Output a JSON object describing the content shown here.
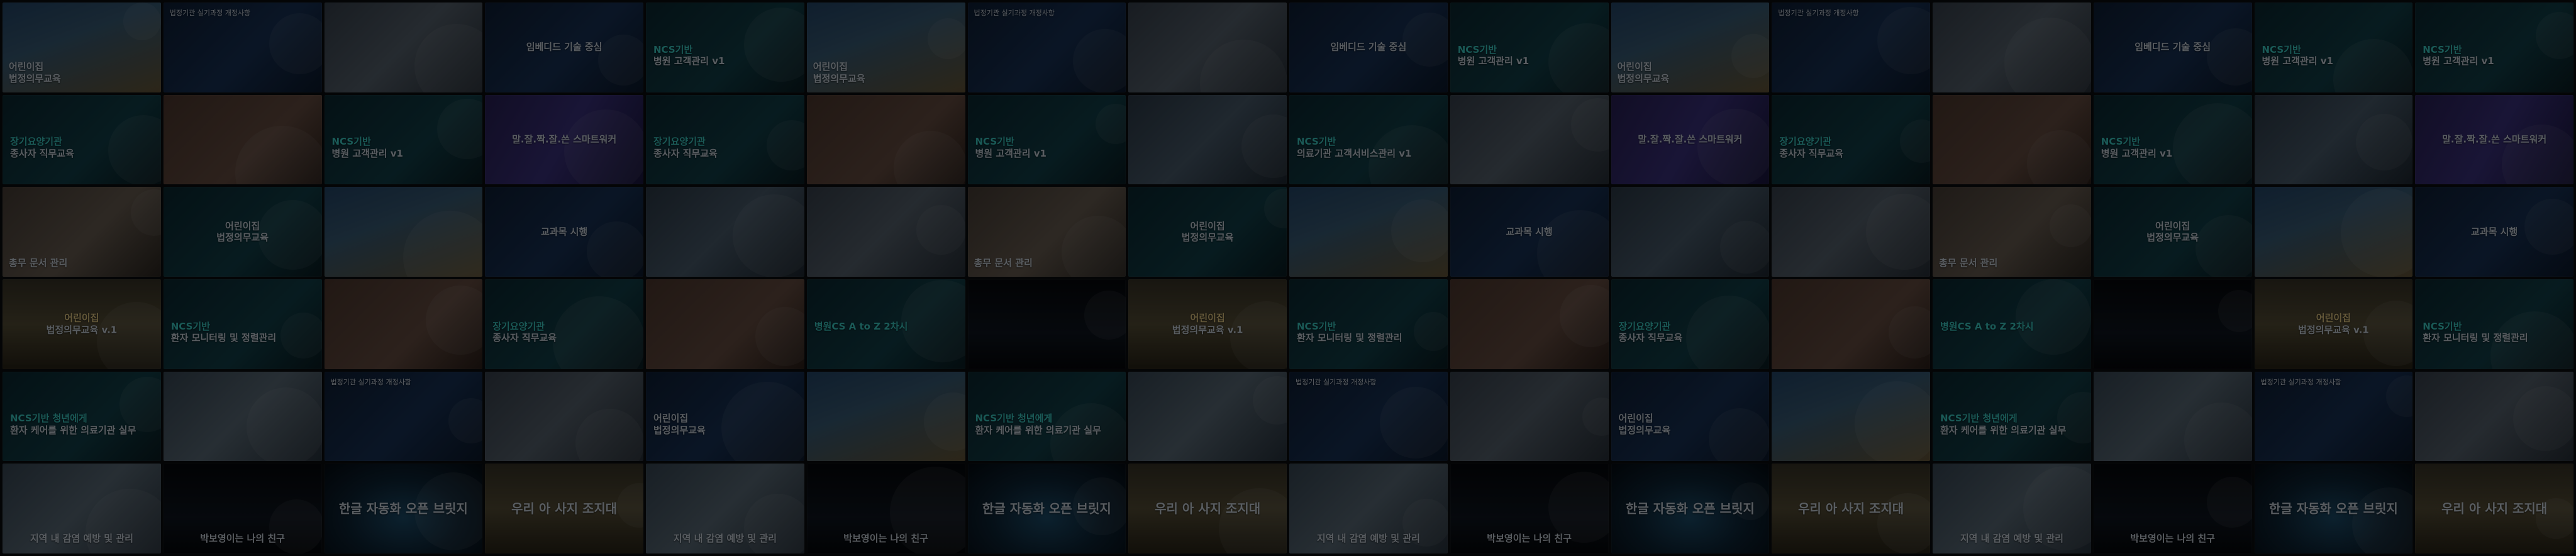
{
  "tiles": [
    {
      "theme": "t-cartoon",
      "texts": [
        {
          "t": "어린이집",
          "c": "pos-bl",
          "a": ""
        },
        {
          "t": "법정의무교육",
          "c": "pos-bl",
          "a": ""
        }
      ]
    },
    {
      "theme": "t-navy",
      "texts": [
        {
          "t": "법정기관 실기과정 개정사항",
          "c": "pos-tl",
          "a": ""
        }
      ]
    },
    {
      "theme": "t-doctor",
      "texts": []
    },
    {
      "theme": "t-navy",
      "texts": [
        {
          "t": "임베디드 기술 중심",
          "c": "pos-c",
          "a": ""
        }
      ]
    },
    {
      "theme": "t-teal",
      "texts": [
        {
          "t": "NCS기반",
          "c": "pos-ml",
          "a": "accent-cyan"
        },
        {
          "t": "병원 고객관리 v1",
          "c": "pos-ml",
          "a": ""
        }
      ]
    },
    {
      "theme": "t-cartoon",
      "texts": [
        {
          "t": "어린이집",
          "c": "pos-bl",
          "a": ""
        },
        {
          "t": "법정의무교육",
          "c": "pos-bl",
          "a": ""
        }
      ]
    },
    {
      "theme": "t-navy",
      "texts": [
        {
          "t": "법정기관 실기과정 개정사항",
          "c": "pos-tl",
          "a": ""
        }
      ]
    },
    {
      "theme": "t-doctor",
      "texts": []
    },
    {
      "theme": "t-navy",
      "texts": [
        {
          "t": "임베디드 기술 중심",
          "c": "pos-c",
          "a": ""
        }
      ]
    },
    {
      "theme": "t-teal",
      "texts": [
        {
          "t": "NCS기반",
          "c": "pos-ml",
          "a": "accent-cyan"
        },
        {
          "t": "병원 고객관리 v1",
          "c": "pos-ml",
          "a": ""
        }
      ]
    },
    {
      "theme": "t-cartoon",
      "texts": [
        {
          "t": "어린이집",
          "c": "pos-bl",
          "a": ""
        },
        {
          "t": "법정의무교육",
          "c": "pos-bl",
          "a": ""
        }
      ]
    },
    {
      "theme": "t-navy",
      "texts": [
        {
          "t": "법정기관 실기과정 개정사항",
          "c": "pos-tl",
          "a": ""
        }
      ]
    },
    {
      "theme": "t-doctor",
      "texts": []
    },
    {
      "theme": "t-navy",
      "texts": [
        {
          "t": "임베디드 기술 중심",
          "c": "pos-c",
          "a": ""
        }
      ]
    },
    {
      "theme": "t-teal",
      "texts": [
        {
          "t": "NCS기반",
          "c": "pos-ml",
          "a": "accent-cyan"
        },
        {
          "t": "병원 고객관리 v1",
          "c": "pos-ml",
          "a": ""
        }
      ]
    },
    {
      "theme": "t-teal",
      "texts": [
        {
          "t": "NCS기반",
          "c": "pos-ml",
          "a": "accent-cyan"
        },
        {
          "t": "병원 고객관리 v1",
          "c": "pos-ml",
          "a": ""
        }
      ]
    },
    {
      "theme": "t-teal",
      "texts": [
        {
          "t": "장기요양기관",
          "c": "pos-ml",
          "a": "accent-cyan"
        },
        {
          "t": "종사자 직무교육",
          "c": "pos-ml",
          "a": ""
        }
      ]
    },
    {
      "theme": "t-hands",
      "texts": []
    },
    {
      "theme": "t-teal",
      "texts": [
        {
          "t": "NCS기반",
          "c": "pos-ml",
          "a": "accent-cyan"
        },
        {
          "t": "병원 고객관리 v1",
          "c": "pos-ml",
          "a": ""
        }
      ]
    },
    {
      "theme": "t-purple",
      "texts": [
        {
          "t": "말.잘.짝.잘.쓴 스마트워커",
          "c": "pos-c",
          "a": ""
        }
      ]
    },
    {
      "theme": "t-teal",
      "texts": [
        {
          "t": "장기요양기관",
          "c": "pos-ml",
          "a": "accent-cyan"
        },
        {
          "t": "종사자 직무교육",
          "c": "pos-ml",
          "a": ""
        }
      ]
    },
    {
      "theme": "t-hands",
      "texts": []
    },
    {
      "theme": "t-teal",
      "texts": [
        {
          "t": "NCS기반",
          "c": "pos-ml",
          "a": "accent-cyan"
        },
        {
          "t": "병원 고객관리 v1",
          "c": "pos-ml",
          "a": ""
        }
      ]
    },
    {
      "theme": "t-med",
      "texts": []
    },
    {
      "theme": "t-teal",
      "texts": [
        {
          "t": "NCS기반",
          "c": "pos-ml",
          "a": "accent-cyan"
        },
        {
          "t": "의료기관 고객서비스관리 v1",
          "c": "pos-ml",
          "a": ""
        }
      ]
    },
    {
      "theme": "t-doctor",
      "texts": []
    },
    {
      "theme": "t-purple",
      "texts": [
        {
          "t": "말.잘.짝.잘.쓴 스마트워커",
          "c": "pos-c",
          "a": ""
        }
      ]
    },
    {
      "theme": "t-teal",
      "texts": [
        {
          "t": "장기요양기관",
          "c": "pos-ml",
          "a": "accent-cyan"
        },
        {
          "t": "종사자 직무교육",
          "c": "pos-ml",
          "a": ""
        }
      ]
    },
    {
      "theme": "t-hands",
      "texts": []
    },
    {
      "theme": "t-teal",
      "texts": [
        {
          "t": "NCS기반",
          "c": "pos-ml",
          "a": "accent-cyan"
        },
        {
          "t": "병원 고객관리 v1",
          "c": "pos-ml",
          "a": ""
        }
      ]
    },
    {
      "theme": "t-med",
      "texts": []
    },
    {
      "theme": "t-purple",
      "texts": [
        {
          "t": "말.잘.짝.잘.쓴 스마트워커",
          "c": "pos-c",
          "a": ""
        }
      ]
    },
    {
      "theme": "t-photo",
      "texts": [
        {
          "t": "총무 문서 관리",
          "c": "pos-bl",
          "a": ""
        }
      ]
    },
    {
      "theme": "t-teal",
      "texts": [
        {
          "t": "어린이집",
          "c": "pos-c",
          "a": ""
        },
        {
          "t": "법정의무교육",
          "c": "pos-c",
          "a": ""
        }
      ]
    },
    {
      "theme": "t-cartoon",
      "texts": []
    },
    {
      "theme": "t-navy",
      "texts": [
        {
          "t": "교과목 시행",
          "c": "pos-c",
          "a": ""
        }
      ]
    },
    {
      "theme": "t-med",
      "texts": []
    },
    {
      "theme": "t-doctor",
      "texts": []
    },
    {
      "theme": "t-photo",
      "texts": [
        {
          "t": "총무 문서 관리",
          "c": "pos-bl",
          "a": ""
        }
      ]
    },
    {
      "theme": "t-teal",
      "texts": [
        {
          "t": "어린이집",
          "c": "pos-c",
          "a": ""
        },
        {
          "t": "법정의무교육",
          "c": "pos-c",
          "a": ""
        }
      ]
    },
    {
      "theme": "t-cartoon",
      "texts": []
    },
    {
      "theme": "t-navy",
      "texts": [
        {
          "t": "교과목 시행",
          "c": "pos-c",
          "a": ""
        }
      ]
    },
    {
      "theme": "t-med",
      "texts": []
    },
    {
      "theme": "t-doctor",
      "texts": []
    },
    {
      "theme": "t-photo",
      "texts": [
        {
          "t": "총무 문서 관리",
          "c": "pos-bl",
          "a": ""
        }
      ]
    },
    {
      "theme": "t-teal",
      "texts": [
        {
          "t": "어린이집",
          "c": "pos-c",
          "a": ""
        },
        {
          "t": "법정의무교육",
          "c": "pos-c",
          "a": ""
        }
      ]
    },
    {
      "theme": "t-cartoon",
      "texts": []
    },
    {
      "theme": "t-navy",
      "texts": [
        {
          "t": "교과목 시행",
          "c": "pos-c",
          "a": ""
        }
      ]
    },
    {
      "theme": "t-gold",
      "texts": [
        {
          "t": "어린이집",
          "c": "pos-c",
          "a": "accent-gold"
        },
        {
          "t": "법정의무교육 v.1",
          "c": "pos-c",
          "a": ""
        }
      ]
    },
    {
      "theme": "t-teal",
      "texts": [
        {
          "t": "NCS기반",
          "c": "pos-ml",
          "a": "accent-cyan"
        },
        {
          "t": "환자 모니터링 및 정렬관리",
          "c": "pos-ml",
          "a": ""
        }
      ]
    },
    {
      "theme": "t-hands",
      "texts": []
    },
    {
      "theme": "t-teal",
      "texts": [
        {
          "t": "장기요양기관",
          "c": "pos-ml",
          "a": "accent-cyan"
        },
        {
          "t": "종사자 직무교육",
          "c": "pos-ml",
          "a": ""
        }
      ]
    },
    {
      "theme": "t-hands",
      "texts": []
    },
    {
      "theme": "t-teal",
      "texts": [
        {
          "t": "병원CS A to Z 2차시",
          "c": "pos-ml",
          "a": "accent-cyan"
        }
      ]
    },
    {
      "theme": "t-dark",
      "texts": []
    },
    {
      "theme": "t-gold",
      "texts": [
        {
          "t": "어린이집",
          "c": "pos-c",
          "a": "accent-gold"
        },
        {
          "t": "법정의무교육 v.1",
          "c": "pos-c",
          "a": ""
        }
      ]
    },
    {
      "theme": "t-teal",
      "texts": [
        {
          "t": "NCS기반",
          "c": "pos-ml",
          "a": "accent-cyan"
        },
        {
          "t": "환자 모니터링 및 정렬관리",
          "c": "pos-ml",
          "a": ""
        }
      ]
    },
    {
      "theme": "t-hands",
      "texts": []
    },
    {
      "theme": "t-teal",
      "texts": [
        {
          "t": "장기요양기관",
          "c": "pos-ml",
          "a": "accent-cyan"
        },
        {
          "t": "종사자 직무교육",
          "c": "pos-ml",
          "a": ""
        }
      ]
    },
    {
      "theme": "t-hands",
      "texts": []
    },
    {
      "theme": "t-teal",
      "texts": [
        {
          "t": "병원CS A to Z 2차시",
          "c": "pos-ml",
          "a": "accent-cyan"
        }
      ]
    },
    {
      "theme": "t-dark",
      "texts": []
    },
    {
      "theme": "t-gold",
      "texts": [
        {
          "t": "어린이집",
          "c": "pos-c",
          "a": "accent-gold"
        },
        {
          "t": "법정의무교육 v.1",
          "c": "pos-c",
          "a": ""
        }
      ]
    },
    {
      "theme": "t-teal",
      "texts": [
        {
          "t": "NCS기반",
          "c": "pos-ml",
          "a": "accent-cyan"
        },
        {
          "t": "환자 모니터링 및 정렬관리",
          "c": "pos-ml",
          "a": ""
        }
      ]
    },
    {
      "theme": "t-teal",
      "texts": [
        {
          "t": "NCS기반 청년에게",
          "c": "pos-ml",
          "a": "accent-cyan"
        },
        {
          "t": "환자 케어를 위한 의료기관 실무",
          "c": "pos-ml",
          "a": ""
        }
      ]
    },
    {
      "theme": "t-person",
      "texts": []
    },
    {
      "theme": "t-navy",
      "texts": [
        {
          "t": "법정기관 실기과정 개정사항",
          "c": "pos-tl",
          "a": ""
        }
      ]
    },
    {
      "theme": "t-doctor",
      "texts": []
    },
    {
      "theme": "t-navy",
      "texts": [
        {
          "t": "어린이집",
          "c": "pos-ml",
          "a": ""
        },
        {
          "t": "법정의무교육",
          "c": "pos-ml",
          "a": ""
        }
      ]
    },
    {
      "theme": "t-cartoon",
      "texts": []
    },
    {
      "theme": "t-teal",
      "texts": [
        {
          "t": "NCS기반 청년에게",
          "c": "pos-ml",
          "a": "accent-cyan"
        },
        {
          "t": "환자 케어를 위한 의료기관 실무",
          "c": "pos-ml",
          "a": ""
        }
      ]
    },
    {
      "theme": "t-person",
      "texts": []
    },
    {
      "theme": "t-navy",
      "texts": [
        {
          "t": "법정기관 실기과정 개정사항",
          "c": "pos-tl",
          "a": ""
        }
      ]
    },
    {
      "theme": "t-doctor",
      "texts": []
    },
    {
      "theme": "t-navy",
      "texts": [
        {
          "t": "어린이집",
          "c": "pos-ml",
          "a": ""
        },
        {
          "t": "법정의무교육",
          "c": "pos-ml",
          "a": ""
        }
      ]
    },
    {
      "theme": "t-cartoon",
      "texts": []
    },
    {
      "theme": "t-teal",
      "texts": [
        {
          "t": "NCS기반 청년에게",
          "c": "pos-ml",
          "a": "accent-cyan"
        },
        {
          "t": "환자 케어를 위한 의료기관 실무",
          "c": "pos-ml",
          "a": ""
        }
      ]
    },
    {
      "theme": "t-person",
      "texts": []
    },
    {
      "theme": "t-navy",
      "texts": [
        {
          "t": "법정기관 실기과정 개정사항",
          "c": "pos-tl",
          "a": ""
        }
      ]
    },
    {
      "theme": "t-doctor",
      "texts": []
    },
    {
      "theme": "t-person",
      "texts": [
        {
          "t": "지역 내 감염 예방 및 관리",
          "c": "pos-cb",
          "a": ""
        }
      ]
    },
    {
      "theme": "t-dark",
      "texts": [
        {
          "t": "박보영이는 나의 친구",
          "c": "pos-cb",
          "a": ""
        }
      ]
    },
    {
      "theme": "t-cyber",
      "texts": [
        {
          "t": "한글 자동화 오픈 브릿지",
          "c": "pos-c",
          "a": "big"
        }
      ]
    },
    {
      "theme": "t-gold",
      "texts": [
        {
          "t": "우리 아 사지 조지대",
          "c": "pos-c",
          "a": "big"
        }
      ]
    },
    {
      "theme": "t-person",
      "texts": [
        {
          "t": "지역 내 감염 예방 및 관리",
          "c": "pos-cb",
          "a": ""
        }
      ]
    },
    {
      "theme": "t-dark",
      "texts": [
        {
          "t": "박보영이는 나의 친구",
          "c": "pos-cb",
          "a": ""
        }
      ]
    },
    {
      "theme": "t-cyber",
      "texts": [
        {
          "t": "한글 자동화 오픈 브릿지",
          "c": "pos-c",
          "a": "big"
        }
      ]
    },
    {
      "theme": "t-gold",
      "texts": [
        {
          "t": "우리 아 사지 조지대",
          "c": "pos-c",
          "a": "big"
        }
      ]
    },
    {
      "theme": "t-person",
      "texts": [
        {
          "t": "지역 내 감염 예방 및 관리",
          "c": "pos-cb",
          "a": ""
        }
      ]
    },
    {
      "theme": "t-dark",
      "texts": [
        {
          "t": "박보영이는 나의 친구",
          "c": "pos-cb",
          "a": ""
        }
      ]
    },
    {
      "theme": "t-cyber",
      "texts": [
        {
          "t": "한글 자동화 오픈 브릿지",
          "c": "pos-c",
          "a": "big"
        }
      ]
    },
    {
      "theme": "t-gold",
      "texts": [
        {
          "t": "우리 아 사지 조지대",
          "c": "pos-c",
          "a": "big"
        }
      ]
    },
    {
      "theme": "t-person",
      "texts": [
        {
          "t": "지역 내 감염 예방 및 관리",
          "c": "pos-cb",
          "a": ""
        }
      ]
    },
    {
      "theme": "t-dark",
      "texts": [
        {
          "t": "박보영이는 나의 친구",
          "c": "pos-cb",
          "a": ""
        }
      ]
    },
    {
      "theme": "t-cyber",
      "texts": [
        {
          "t": "한글 자동화 오픈 브릿지",
          "c": "pos-c",
          "a": "big"
        }
      ]
    },
    {
      "theme": "t-gold",
      "texts": [
        {
          "t": "우리 아 사지 조지대",
          "c": "pos-c",
          "a": "big"
        }
      ]
    }
  ]
}
